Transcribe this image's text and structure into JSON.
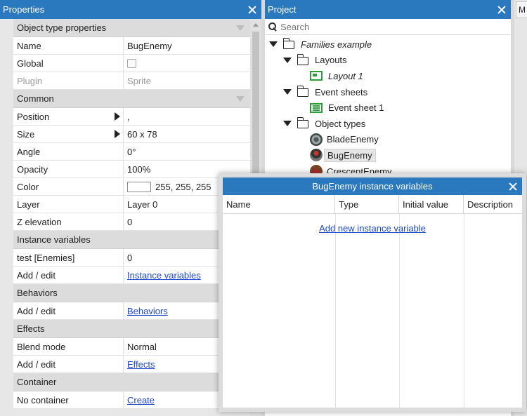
{
  "properties": {
    "title": "Properties",
    "sections": [
      {
        "title": "Object type properties",
        "rows": [
          {
            "name": "Name",
            "value": "BugEnemy",
            "kind": "text"
          },
          {
            "name": "Global",
            "value": "",
            "kind": "checkbox"
          },
          {
            "name": "Plugin",
            "value": "Sprite",
            "kind": "disabled"
          }
        ]
      },
      {
        "title": "Common",
        "rows": [
          {
            "name": "Position",
            "value": ",",
            "kind": "expand"
          },
          {
            "name": "Size",
            "value": "60 x 78",
            "kind": "expand"
          },
          {
            "name": "Angle",
            "value": "0°",
            "kind": "text"
          },
          {
            "name": "Opacity",
            "value": "100%",
            "kind": "text"
          },
          {
            "name": "Color",
            "value": "255, 255, 255",
            "kind": "color"
          },
          {
            "name": "Layer",
            "value": "Layer 0",
            "kind": "text"
          },
          {
            "name": "Z elevation",
            "value": "0",
            "kind": "text"
          }
        ]
      },
      {
        "title": "Instance variables",
        "rows": [
          {
            "name": "test [Enemies]",
            "value": "0",
            "kind": "text"
          },
          {
            "name": "Add / edit",
            "value": "Instance variables",
            "kind": "link"
          }
        ]
      },
      {
        "title": "Behaviors",
        "rows": [
          {
            "name": "Add / edit",
            "value": "Behaviors",
            "kind": "link"
          }
        ]
      },
      {
        "title": "Effects",
        "rows": [
          {
            "name": "Blend mode",
            "value": "Normal",
            "kind": "text"
          },
          {
            "name": "Add / edit",
            "value": "Effects",
            "kind": "link"
          }
        ]
      },
      {
        "title": "Container",
        "rows": [
          {
            "name": "No container",
            "value": "Create",
            "kind": "link"
          }
        ]
      }
    ]
  },
  "project": {
    "title": "Project",
    "search_placeholder": "Search",
    "tree": {
      "root": "Families example",
      "layouts_folder": "Layouts",
      "layout_item": "Layout 1",
      "events_folder": "Event sheets",
      "event_item": "Event sheet 1",
      "objects_folder": "Object types",
      "objects": [
        "BladeEnemy",
        "BugEnemy",
        "CrescentEnemy"
      ]
    }
  },
  "right_tab": {
    "label": "M"
  },
  "dialog": {
    "title": "BugEnemy instance variables",
    "columns": [
      "Name",
      "Type",
      "Initial value",
      "Description"
    ],
    "add_link": "Add new instance variable"
  }
}
